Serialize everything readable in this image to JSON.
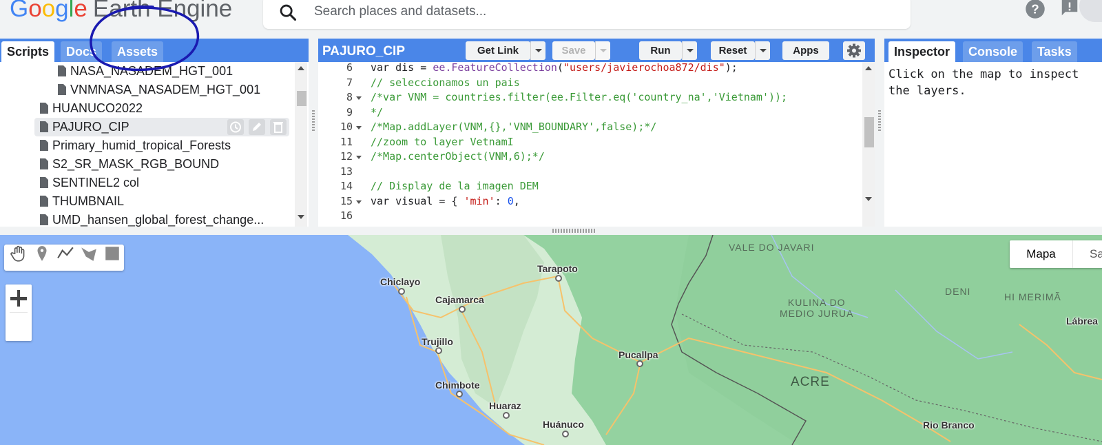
{
  "app": {
    "logo_google": [
      "G",
      "o",
      "o",
      "g",
      "l",
      "e"
    ],
    "logo_product": "Earth Engine",
    "search_placeholder": "Search places and datasets..."
  },
  "left_panel": {
    "tabs": [
      {
        "label": "Scripts",
        "active": true
      },
      {
        "label": "Docs",
        "active": false
      },
      {
        "label": "Assets",
        "active": false
      }
    ],
    "tree": [
      {
        "label": "NASA_NASADEM_HGT_001",
        "indent": 2
      },
      {
        "label": "VNMNASA_NASADEM_HGT_001",
        "indent": 2
      },
      {
        "label": "HUANUCO2022",
        "indent": 1
      },
      {
        "label": "PAJURO_CIP",
        "indent": 1,
        "selected": true
      },
      {
        "label": "Primary_humid_tropical_Forests",
        "indent": 1
      },
      {
        "label": "S2_SR_MASK_RGB_BOUND",
        "indent": 1
      },
      {
        "label": "SENTINEL2 col",
        "indent": 1
      },
      {
        "label": "THUMBNAIL",
        "indent": 1
      },
      {
        "label": "UMD_hansen_global_forest_change...",
        "indent": 1
      }
    ],
    "row_action_icons": [
      "history-icon",
      "edit-icon",
      "delete-icon"
    ]
  },
  "editor": {
    "title": "PAJURO_CIP",
    "buttons": {
      "get_link": "Get Link",
      "save": "Save",
      "run": "Run",
      "reset": "Reset",
      "apps": "Apps"
    },
    "lines": [
      {
        "n": "6",
        "fold": false,
        "tokens": [
          [
            "kw",
            "var dis = "
          ],
          [
            "fn",
            "ee.FeatureCollection"
          ],
          [
            "kw",
            "("
          ],
          [
            "str",
            "\"users/javierochoa872/dis\""
          ],
          [
            "kw",
            ");"
          ]
        ]
      },
      {
        "n": "7",
        "fold": false,
        "tokens": [
          [
            "cm",
            "// seleccionamos un pais"
          ]
        ]
      },
      {
        "n": "8",
        "fold": true,
        "tokens": [
          [
            "cm",
            "/*var VNM = countries.filter(ee.Filter.eq('country_na','Vietnam'));"
          ]
        ]
      },
      {
        "n": "9",
        "fold": false,
        "tokens": [
          [
            "cm",
            "*/"
          ]
        ]
      },
      {
        "n": "10",
        "fold": true,
        "tokens": [
          [
            "cm",
            "/*Map.addLayer(VNM,{},'VNM_BOUNDARY',false);*/"
          ]
        ]
      },
      {
        "n": "11",
        "fold": false,
        "tokens": [
          [
            "cm",
            "//zoom to layer VetnamI"
          ]
        ]
      },
      {
        "n": "12",
        "fold": true,
        "tokens": [
          [
            "cm",
            "/*Map.centerObject(VNM,6);*/"
          ]
        ]
      },
      {
        "n": "13",
        "fold": false,
        "tokens": []
      },
      {
        "n": "14",
        "fold": false,
        "tokens": [
          [
            "cm",
            "// Display de la imagen DEM"
          ]
        ]
      },
      {
        "n": "15",
        "fold": true,
        "tokens": [
          [
            "kw",
            "var visual = { "
          ],
          [
            "str",
            "'min'"
          ],
          [
            "kw",
            ": "
          ],
          [
            "num",
            "0"
          ],
          [
            "kw",
            ","
          ]
        ]
      },
      {
        "n": "16",
        "fold": false,
        "tokens": []
      }
    ]
  },
  "right_panel": {
    "tabs": [
      {
        "label": "Inspector",
        "active": true
      },
      {
        "label": "Console",
        "active": false
      },
      {
        "label": "Tasks",
        "active": false
      }
    ],
    "inspector_text": "Click on the map to inspect the layers."
  },
  "map": {
    "maptype": {
      "map": "Mapa",
      "satellite": "Sa"
    },
    "cities": [
      "Chiclayo",
      "Cajamarca",
      "Tarapoto",
      "Trujillo",
      "Pucallpa",
      "Chimbote",
      "Huaraz",
      "Huánuco",
      "Rio Branco",
      "Lábrea"
    ],
    "regions": [
      "VALE DO JAVARI",
      "KULINA DO\nMEDIO JURUA",
      "DENI",
      "HI MERIMÃ",
      "ACRE"
    ],
    "colors": {
      "ocean": "#8ab4f8",
      "land_light": "#d4ecd4",
      "land_green": "#94d2a0",
      "land_dark": "#7fc08c",
      "roads": "#f6c26b"
    }
  }
}
